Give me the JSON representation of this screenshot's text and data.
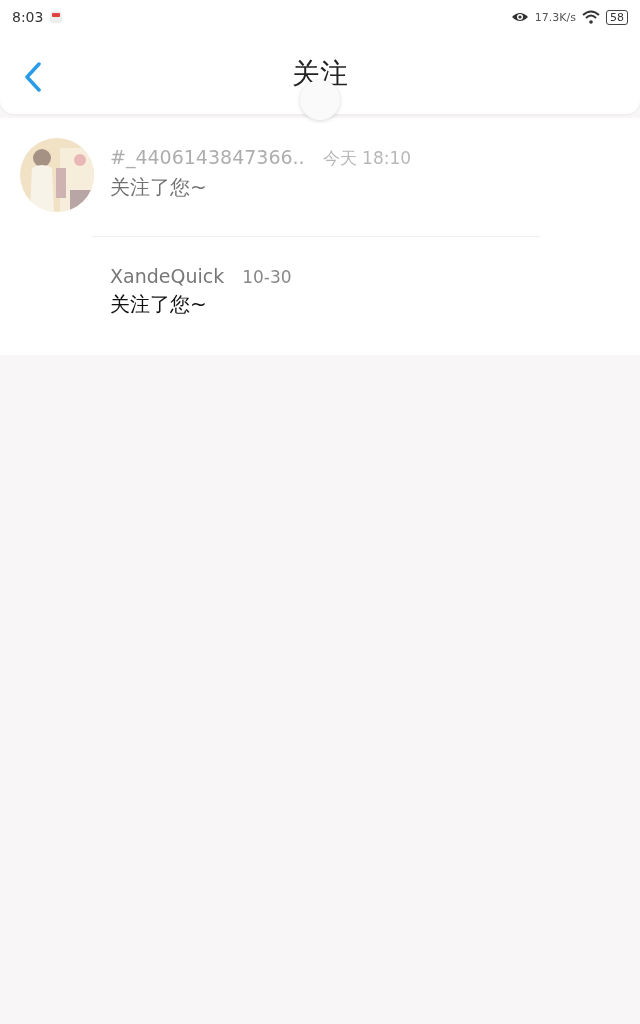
{
  "status_bar": {
    "time": "8:03",
    "net_speed": "17.3K/s",
    "battery": "58"
  },
  "header": {
    "title": "关注"
  },
  "refresh_indicator": {
    "visible": true
  },
  "notifications": [
    {
      "name": "#_4406143847366..",
      "time": "今天 18:10",
      "message": "关注了您~",
      "avatar": true,
      "dimmed": true
    },
    {
      "name": "XandeQuick",
      "time": "10-30",
      "message": "关注了您~",
      "avatar": false,
      "dimmed": false
    }
  ]
}
